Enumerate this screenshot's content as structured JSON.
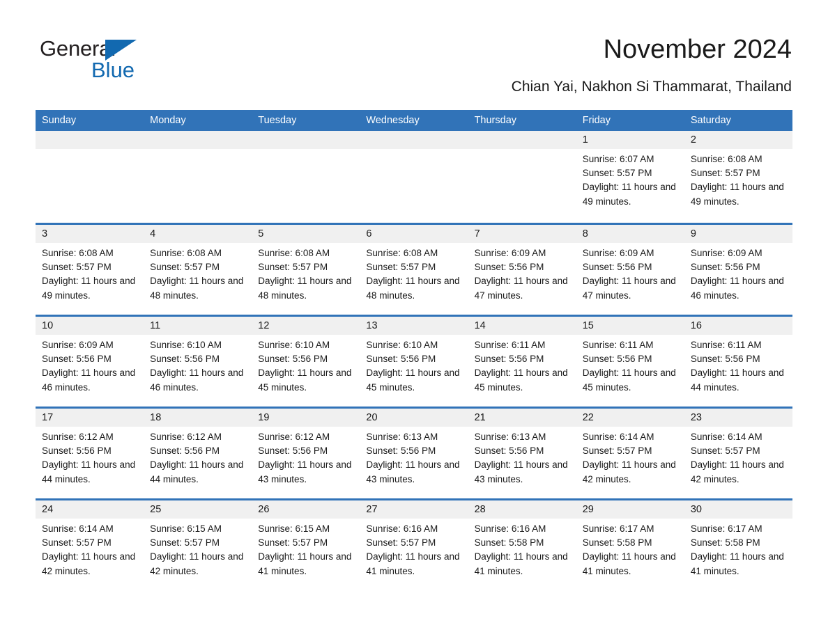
{
  "brand": {
    "name_part1": "General",
    "name_part2": "Blue",
    "accent_color": "#1269b0"
  },
  "header": {
    "title": "November 2024",
    "subtitle": "Chian Yai, Nakhon Si Thammarat, Thailand"
  },
  "theme": {
    "header_blue": "#3173b8",
    "day_band_gray": "#f0f0f0",
    "text_color": "#1a1a1a"
  },
  "calendar": {
    "weekdays": [
      "Sunday",
      "Monday",
      "Tuesday",
      "Wednesday",
      "Thursday",
      "Friday",
      "Saturday"
    ],
    "weeks": [
      [
        {
          "day": "",
          "empty": true
        },
        {
          "day": "",
          "empty": true
        },
        {
          "day": "",
          "empty": true
        },
        {
          "day": "",
          "empty": true
        },
        {
          "day": "",
          "empty": true
        },
        {
          "day": "1",
          "sunrise": "Sunrise: 6:07 AM",
          "sunset": "Sunset: 5:57 PM",
          "daylight": "Daylight: 11 hours and 49 minutes."
        },
        {
          "day": "2",
          "sunrise": "Sunrise: 6:08 AM",
          "sunset": "Sunset: 5:57 PM",
          "daylight": "Daylight: 11 hours and 49 minutes."
        }
      ],
      [
        {
          "day": "3",
          "sunrise": "Sunrise: 6:08 AM",
          "sunset": "Sunset: 5:57 PM",
          "daylight": "Daylight: 11 hours and 49 minutes."
        },
        {
          "day": "4",
          "sunrise": "Sunrise: 6:08 AM",
          "sunset": "Sunset: 5:57 PM",
          "daylight": "Daylight: 11 hours and 48 minutes."
        },
        {
          "day": "5",
          "sunrise": "Sunrise: 6:08 AM",
          "sunset": "Sunset: 5:57 PM",
          "daylight": "Daylight: 11 hours and 48 minutes."
        },
        {
          "day": "6",
          "sunrise": "Sunrise: 6:08 AM",
          "sunset": "Sunset: 5:57 PM",
          "daylight": "Daylight: 11 hours and 48 minutes."
        },
        {
          "day": "7",
          "sunrise": "Sunrise: 6:09 AM",
          "sunset": "Sunset: 5:56 PM",
          "daylight": "Daylight: 11 hours and 47 minutes."
        },
        {
          "day": "8",
          "sunrise": "Sunrise: 6:09 AM",
          "sunset": "Sunset: 5:56 PM",
          "daylight": "Daylight: 11 hours and 47 minutes."
        },
        {
          "day": "9",
          "sunrise": "Sunrise: 6:09 AM",
          "sunset": "Sunset: 5:56 PM",
          "daylight": "Daylight: 11 hours and 46 minutes."
        }
      ],
      [
        {
          "day": "10",
          "sunrise": "Sunrise: 6:09 AM",
          "sunset": "Sunset: 5:56 PM",
          "daylight": "Daylight: 11 hours and 46 minutes."
        },
        {
          "day": "11",
          "sunrise": "Sunrise: 6:10 AM",
          "sunset": "Sunset: 5:56 PM",
          "daylight": "Daylight: 11 hours and 46 minutes."
        },
        {
          "day": "12",
          "sunrise": "Sunrise: 6:10 AM",
          "sunset": "Sunset: 5:56 PM",
          "daylight": "Daylight: 11 hours and 45 minutes."
        },
        {
          "day": "13",
          "sunrise": "Sunrise: 6:10 AM",
          "sunset": "Sunset: 5:56 PM",
          "daylight": "Daylight: 11 hours and 45 minutes."
        },
        {
          "day": "14",
          "sunrise": "Sunrise: 6:11 AM",
          "sunset": "Sunset: 5:56 PM",
          "daylight": "Daylight: 11 hours and 45 minutes."
        },
        {
          "day": "15",
          "sunrise": "Sunrise: 6:11 AM",
          "sunset": "Sunset: 5:56 PM",
          "daylight": "Daylight: 11 hours and 45 minutes."
        },
        {
          "day": "16",
          "sunrise": "Sunrise: 6:11 AM",
          "sunset": "Sunset: 5:56 PM",
          "daylight": "Daylight: 11 hours and 44 minutes."
        }
      ],
      [
        {
          "day": "17",
          "sunrise": "Sunrise: 6:12 AM",
          "sunset": "Sunset: 5:56 PM",
          "daylight": "Daylight: 11 hours and 44 minutes."
        },
        {
          "day": "18",
          "sunrise": "Sunrise: 6:12 AM",
          "sunset": "Sunset: 5:56 PM",
          "daylight": "Daylight: 11 hours and 44 minutes."
        },
        {
          "day": "19",
          "sunrise": "Sunrise: 6:12 AM",
          "sunset": "Sunset: 5:56 PM",
          "daylight": "Daylight: 11 hours and 43 minutes."
        },
        {
          "day": "20",
          "sunrise": "Sunrise: 6:13 AM",
          "sunset": "Sunset: 5:56 PM",
          "daylight": "Daylight: 11 hours and 43 minutes."
        },
        {
          "day": "21",
          "sunrise": "Sunrise: 6:13 AM",
          "sunset": "Sunset: 5:56 PM",
          "daylight": "Daylight: 11 hours and 43 minutes."
        },
        {
          "day": "22",
          "sunrise": "Sunrise: 6:14 AM",
          "sunset": "Sunset: 5:57 PM",
          "daylight": "Daylight: 11 hours and 42 minutes."
        },
        {
          "day": "23",
          "sunrise": "Sunrise: 6:14 AM",
          "sunset": "Sunset: 5:57 PM",
          "daylight": "Daylight: 11 hours and 42 minutes."
        }
      ],
      [
        {
          "day": "24",
          "sunrise": "Sunrise: 6:14 AM",
          "sunset": "Sunset: 5:57 PM",
          "daylight": "Daylight: 11 hours and 42 minutes."
        },
        {
          "day": "25",
          "sunrise": "Sunrise: 6:15 AM",
          "sunset": "Sunset: 5:57 PM",
          "daylight": "Daylight: 11 hours and 42 minutes."
        },
        {
          "day": "26",
          "sunrise": "Sunrise: 6:15 AM",
          "sunset": "Sunset: 5:57 PM",
          "daylight": "Daylight: 11 hours and 41 minutes."
        },
        {
          "day": "27",
          "sunrise": "Sunrise: 6:16 AM",
          "sunset": "Sunset: 5:57 PM",
          "daylight": "Daylight: 11 hours and 41 minutes."
        },
        {
          "day": "28",
          "sunrise": "Sunrise: 6:16 AM",
          "sunset": "Sunset: 5:58 PM",
          "daylight": "Daylight: 11 hours and 41 minutes."
        },
        {
          "day": "29",
          "sunrise": "Sunrise: 6:17 AM",
          "sunset": "Sunset: 5:58 PM",
          "daylight": "Daylight: 11 hours and 41 minutes."
        },
        {
          "day": "30",
          "sunrise": "Sunrise: 6:17 AM",
          "sunset": "Sunset: 5:58 PM",
          "daylight": "Daylight: 11 hours and 41 minutes."
        }
      ]
    ]
  }
}
